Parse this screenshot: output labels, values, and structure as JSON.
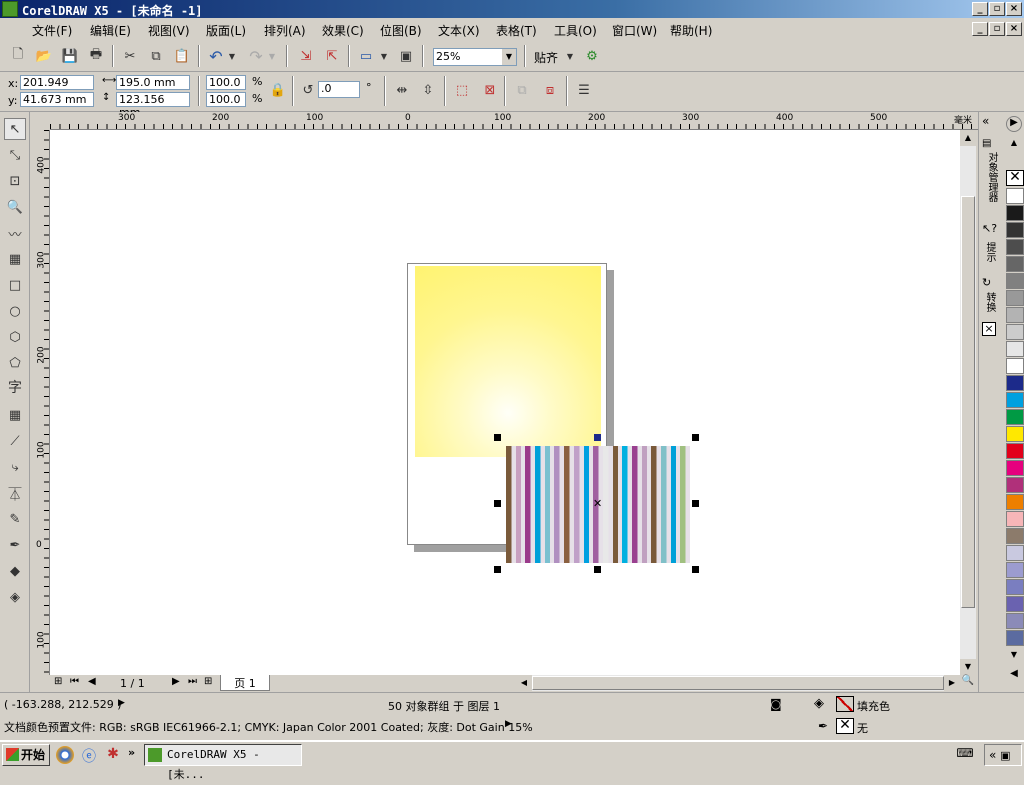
{
  "window": {
    "title": "CorelDRAW X5 - [未命名 -1]"
  },
  "menu": [
    "文件(F)",
    "编辑(E)",
    "视图(V)",
    "版面(L)",
    "排列(A)",
    "效果(C)",
    "位图(B)",
    "文本(X)",
    "表格(T)",
    "工具(O)",
    "窗口(W)",
    "帮助(H)"
  ],
  "toolbar": {
    "zoom_value": "25%",
    "snap_label": "贴齐"
  },
  "propbar": {
    "x_label": "x:",
    "x_value": "201.949 mm",
    "y_label": "y:",
    "y_value": "41.673 mm",
    "width_value": "195.0 mm",
    "height_value": "123.156 mm",
    "scale_x": "100.0",
    "scale_y": "100.0",
    "percent": "%",
    "rotation": ".0",
    "degree": "°"
  },
  "ruler": {
    "unit": "毫米",
    "h_ticks": [
      "300",
      "200",
      "100",
      "0",
      "100",
      "200",
      "300",
      "400",
      "500"
    ],
    "v_ticks": [
      "400",
      "300",
      "200",
      "100",
      "0",
      "100"
    ]
  },
  "docker": {
    "tab_object_manager": "对象管理器",
    "tab_hints": "提示",
    "tab_transform": "转换"
  },
  "palette_colors": [
    "#ffffff",
    "#1a1a1a",
    "#333333",
    "#4d4d4d",
    "#666666",
    "#808080",
    "#999999",
    "#b3b3b3",
    "#cccccc",
    "#e6e6e6",
    "#ffffff",
    "#1c2a8a",
    "#00a0e0",
    "#009a44",
    "#ffe800",
    "#e2001a",
    "#e6007e",
    "#b0307a",
    "#ee7f00",
    "#f7b6b8",
    "#8c7b6b",
    "#c9c9e0",
    "#9c9cd0",
    "#7a7ec0",
    "#6a62b0",
    "#8b8bb8",
    "#5b6ba0"
  ],
  "page_nav": {
    "counter": "1 / 1",
    "page_tab": "页 1"
  },
  "status": {
    "coords": "( -163.288, 212.529 )",
    "selection": "50 对象群组 于 图层 1",
    "fill_label": "填充色",
    "outline_label": "无",
    "color_profile": "文档颜色预置文件: RGB: sRGB IEC61966-2.1; CMYK: Japan Color 2001 Coated; 灰度: Dot Gain 15%"
  },
  "taskbar": {
    "start_label": "开始",
    "task_label": "CorelDRAW X5 - [未..."
  },
  "stripes": [
    "#7a5a3a",
    "#c8a0c0",
    "#9a3a8a",
    "#00a0d8",
    "#7ac0d0",
    "#b090c0",
    "#8a6040",
    "#c0a0c8",
    "#00a0e0",
    "#a060a0",
    "#e8e8e8",
    "#7a5a3a",
    "#00b0e0",
    "#9a4090",
    "#c0a0c0",
    "#7a5a3a",
    "#80c0c8",
    "#00a0d8",
    "#a0c080"
  ]
}
